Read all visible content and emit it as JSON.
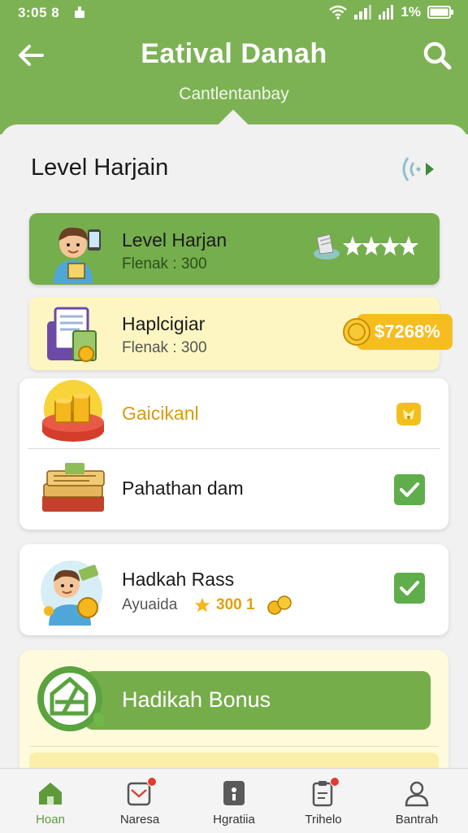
{
  "status_bar": {
    "time": "3:05 8",
    "battery_text": "1%"
  },
  "header": {
    "title": "Eatival Danah",
    "subtitle": "Cantlentanbay"
  },
  "section": {
    "title": "Level Harjain"
  },
  "items": [
    {
      "title": "Level Harjan",
      "subtitle": "Flenak : 300",
      "rating_stars": 4
    },
    {
      "title": "Haplcigiar",
      "subtitle": "Flenak : 300",
      "price": "$7268%"
    },
    {
      "title": "Gaicikanl"
    },
    {
      "title": "Pahathan dam",
      "checked": true
    },
    {
      "title": "Hadkah Rass",
      "subtitle": "Ayuaida",
      "points": "300 1",
      "checked": true
    }
  ],
  "bonus": {
    "label": "Hadikah Bonus"
  },
  "nav": [
    {
      "label": "Hoan",
      "icon": "home-icon",
      "active": true
    },
    {
      "label": "Naresa",
      "icon": "mail-icon",
      "badge": true
    },
    {
      "label": "Hgratiia",
      "icon": "document-icon"
    },
    {
      "label": "Trihelo",
      "icon": "clipboard-icon",
      "badge": true
    },
    {
      "label": "Bantrah",
      "icon": "user-icon"
    }
  ],
  "colors": {
    "header_green": "#7cb254",
    "card_green": "#75ae4c",
    "card_yellow": "#fdf6c3",
    "price_gold": "#f6bd20",
    "check_green": "#5fae4b",
    "badge_red": "#e33a2f"
  }
}
